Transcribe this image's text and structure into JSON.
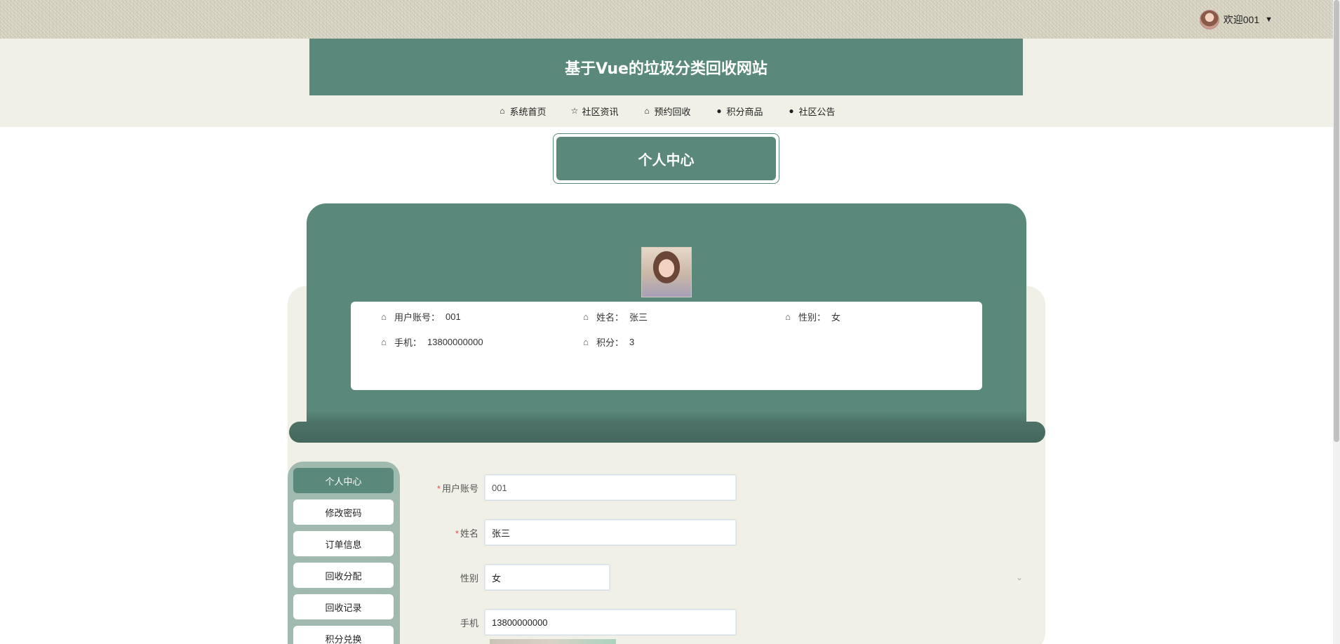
{
  "topbar": {
    "welcome": "欢迎001",
    "caret_icon": "caret-down-icon"
  },
  "site": {
    "title": "基于Vue的垃圾分类回收网站"
  },
  "nav": {
    "items": [
      {
        "label": "系统首页",
        "icon": "home-icon"
      },
      {
        "label": "社区资讯",
        "icon": "star-icon"
      },
      {
        "label": "预约回收",
        "icon": "bag-icon"
      },
      {
        "label": "积分商品",
        "icon": "info-icon"
      },
      {
        "label": "社区公告",
        "icon": "question-icon"
      }
    ]
  },
  "page": {
    "heading": "个人中心"
  },
  "profile": {
    "fields": [
      {
        "label": "用户账号：",
        "value": "001"
      },
      {
        "label": "姓名：",
        "value": "张三"
      },
      {
        "label": "性别：",
        "value": "女"
      },
      {
        "label": "手机：",
        "value": "13800000000"
      },
      {
        "label": "积分：",
        "value": "3"
      }
    ]
  },
  "sidebar": {
    "items": [
      {
        "label": "个人中心",
        "active": true
      },
      {
        "label": "修改密码",
        "active": false
      },
      {
        "label": "订单信息",
        "active": false
      },
      {
        "label": "回收分配",
        "active": false
      },
      {
        "label": "回收记录",
        "active": false
      },
      {
        "label": "积分兑换",
        "active": false
      }
    ]
  },
  "form": {
    "account": {
      "label": "用户账号",
      "value": "001",
      "required": true
    },
    "name": {
      "label": "姓名",
      "value": "张三",
      "required": true
    },
    "gender": {
      "label": "性别",
      "value": "女",
      "required": false
    },
    "phone": {
      "label": "手机",
      "value": "13800000000",
      "required": false
    }
  },
  "colors": {
    "primary": "#5a897b",
    "beige": "#f0f0e6",
    "sidebar": "#a1bab0",
    "required": "#e05050"
  }
}
